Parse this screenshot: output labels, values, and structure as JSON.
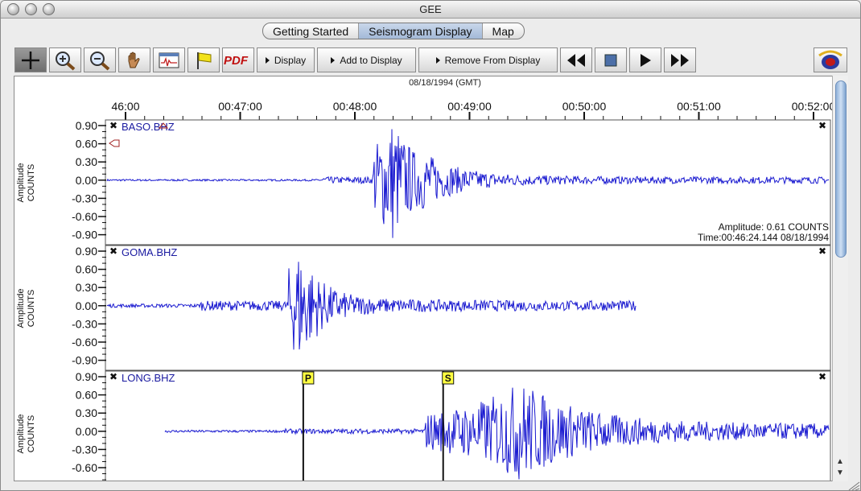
{
  "window": {
    "title": "GEE"
  },
  "tabs": [
    {
      "label": "Getting Started",
      "active": false
    },
    {
      "label": "Seismogram Display",
      "active": true
    },
    {
      "label": "Map",
      "active": false
    }
  ],
  "toolbar": {
    "tools": [
      {
        "name": "crosshair-tool-icon",
        "selected": true
      },
      {
        "name": "zoom-in-icon",
        "selected": false
      },
      {
        "name": "zoom-out-icon",
        "selected": false
      },
      {
        "name": "hand-pan-icon",
        "selected": false
      },
      {
        "name": "select-window-icon",
        "selected": false
      },
      {
        "name": "flag-icon",
        "selected": false
      }
    ],
    "pdf_label": "PDF",
    "display_label": "Display",
    "add_label": "Add to Display",
    "remove_label": "Remove From Display",
    "playback_icons": [
      "rewind-icon",
      "stop-icon",
      "play-icon",
      "fast-forward-icon"
    ],
    "logo_icon": "seismic-logo-icon"
  },
  "time_axis": {
    "date_label": "08/18/1994 (GMT)",
    "ticks": [
      "46:00",
      "00:47:00",
      "00:48:00",
      "00:49:00",
      "00:50:00",
      "00:51:00",
      "00:52:00"
    ]
  },
  "amplitude_ticks": [
    "0.90",
    "0.60",
    "0.30",
    "0.00",
    "-0.30",
    "-0.60",
    "-0.90"
  ],
  "ylabel_line1": "Amplitude",
  "ylabel_line2": "COUNTS",
  "seismograms": [
    {
      "station": "BASO.BHZ",
      "readout_amplitude": "Amplitude: 0.61 COUNTS",
      "readout_time": "Time:00:46:24.144 08/18/1994"
    },
    {
      "station": "GOMA.BHZ"
    },
    {
      "station": "LONG.BHZ",
      "phase_picks": [
        {
          "label": "P",
          "minute_offset": 1.55
        },
        {
          "label": "S",
          "minute_offset": 2.77
        }
      ]
    }
  ],
  "colors": {
    "trace": "#1a1ad0",
    "pick_flag": "#ffff40",
    "tab_active": "#a9bedc"
  }
}
